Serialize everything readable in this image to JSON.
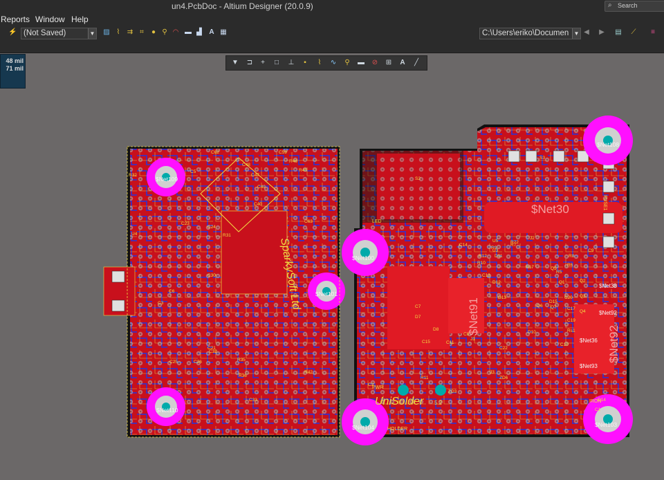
{
  "window": {
    "title": "un4.PcbDoc - Altium Designer (20.0.9)",
    "search_placeholder": "Search"
  },
  "menu": {
    "items": [
      "Reports",
      "Window",
      "Help"
    ]
  },
  "toolbar": {
    "variant_combo": "(Not Saved)",
    "path_combo": "C:\\Users\\eriko\\Documen"
  },
  "coord_panel": {
    "line1": "48 mil",
    "line2": "71 mil"
  },
  "icons": [
    "search-icon",
    "filter-icon",
    "route-icon",
    "place-pad-icon",
    "text-icon",
    "line-icon"
  ],
  "colors": {
    "board": "#c8101c",
    "copper_bottom": "#2a33d6",
    "pad": "#b9b9b9",
    "highlight": "#ff10ff",
    "silk": "#f2dc42",
    "background": "#6b6868"
  },
  "pcb": {
    "net_labels": [
      "$Net108",
      "$Net109",
      "$Net100",
      "$Net101",
      "$Net104",
      "$Net103",
      "$Net110",
      "$Net30",
      "$Net91",
      "$Net92",
      "$Net38",
      "$Net36",
      "$Net93"
    ],
    "silk_texts": [
      "SparkySoft Ltd",
      "UniSolder",
      "5.2",
      "HOLDER",
      "IRON",
      "PWR",
      "FUSE1",
      "LED"
    ],
    "designators": [
      "R32",
      "C5",
      "C62",
      "C59",
      "C48",
      "C47",
      "C40",
      "C49",
      "C63",
      "R46",
      "R45",
      "U4",
      "C23",
      "C24",
      "C25",
      "C21",
      "C26",
      "C30",
      "C32",
      "C33",
      "R31",
      "R35",
      "R36",
      "R42",
      "C14",
      "C15",
      "C12",
      "C11",
      "C7",
      "C8",
      "C22",
      "D7",
      "D8",
      "D9",
      "D10",
      "D11",
      "D12",
      "D13",
      "D14",
      "D15",
      "D16",
      "Q1",
      "Q2",
      "Q3",
      "Q4",
      "Q5",
      "Q6",
      "Q7",
      "R1",
      "R2",
      "R3",
      "R4",
      "R5",
      "R6",
      "R7",
      "R8",
      "R9",
      "R10",
      "R11",
      "R12",
      "R13",
      "R14",
      "R15",
      "R16",
      "R17",
      "R18",
      "R20",
      "R22",
      "ZD1",
      "ZD2",
      "ZD3",
      "ZD6",
      "U3",
      "U5",
      "J1",
      "J2",
      "J3",
      "S2",
      "S3",
      "C1",
      "C2",
      "C3",
      "C6",
      "C9",
      "C10",
      "C19",
      "C20",
      "C17",
      "Rs1"
    ]
  }
}
